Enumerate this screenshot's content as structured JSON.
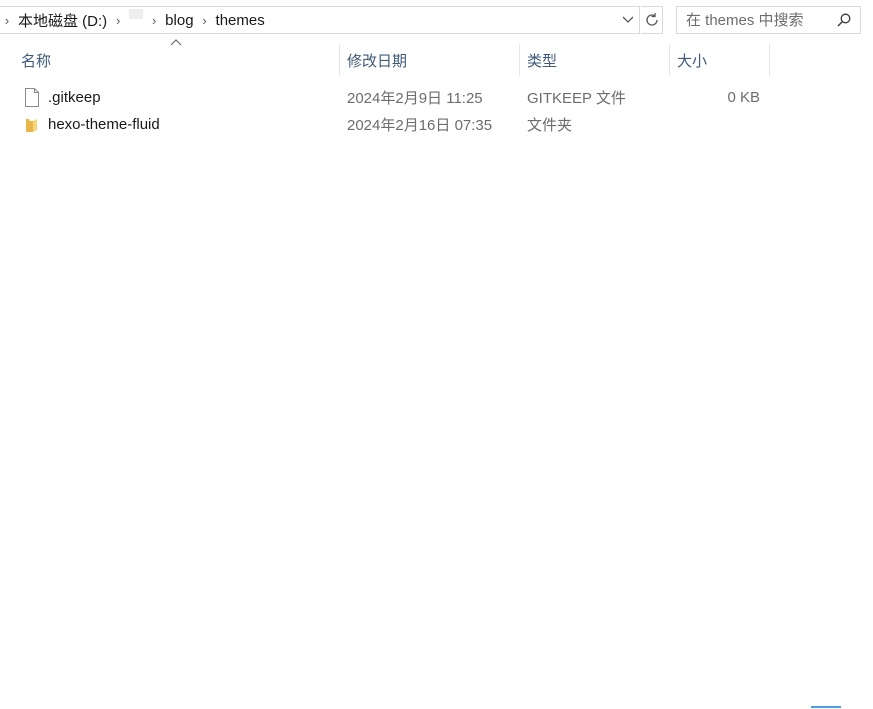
{
  "address_bar": {
    "crumbs": [
      "本地磁盘 (D:)",
      "blog",
      "themes"
    ]
  },
  "search": {
    "placeholder": "在 themes 中搜索"
  },
  "columns": {
    "name": "名称",
    "date": "修改日期",
    "type": "类型",
    "size": "大小"
  },
  "files": [
    {
      "icon": "file-icon",
      "name": ".gitkeep",
      "date": "2024年2月9日 11:25",
      "type": "GITKEEP 文件",
      "size": "0 KB"
    },
    {
      "icon": "folder-icon",
      "name": "hexo-theme-fluid",
      "date": "2024年2月16日 07:35",
      "type": "文件夹",
      "size": ""
    }
  ]
}
